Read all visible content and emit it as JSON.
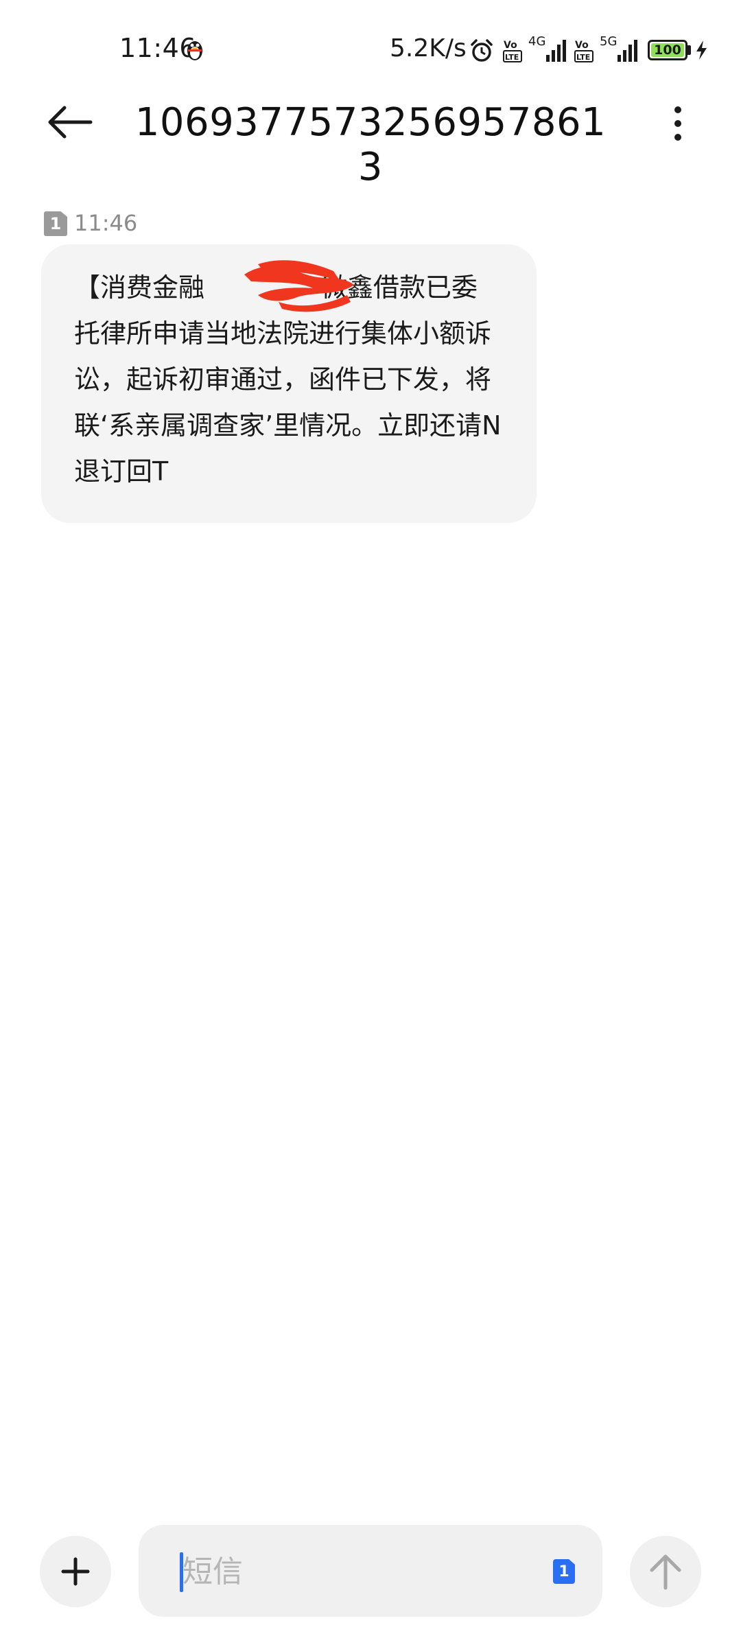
{
  "status_bar": {
    "time": "11:46",
    "network_speed": "5.2K/s",
    "signal1_type": "4G",
    "signal2_type": "5G",
    "battery": "100",
    "icons": [
      "qq-penguin-icon",
      "alarm-icon",
      "volte-icon",
      "signal-icon",
      "battery-icon",
      "charging-icon"
    ],
    "battery_color": "#8ee05a"
  },
  "header": {
    "title": "1069377573256957861​3",
    "back_icon": "arrow-left-icon",
    "more_icon": "more-vertical-icon"
  },
  "conversation": {
    "messages": [
      {
        "sim_label": "1",
        "time": "11:46",
        "text_before": "【消费金融",
        "text_after": "微鑫借款已委托律所申请当地法院进行集体小额诉讼，起诉初审通过，函件已下发，将联‘系亲属调查家’里情况。立即还请N退订回T"
      }
    ]
  },
  "composer": {
    "placeholder": "短信",
    "sim_label": "1",
    "add_icon": "plus-icon",
    "send_icon": "arrow-up-icon",
    "accent_color": "#2a6ff2"
  }
}
